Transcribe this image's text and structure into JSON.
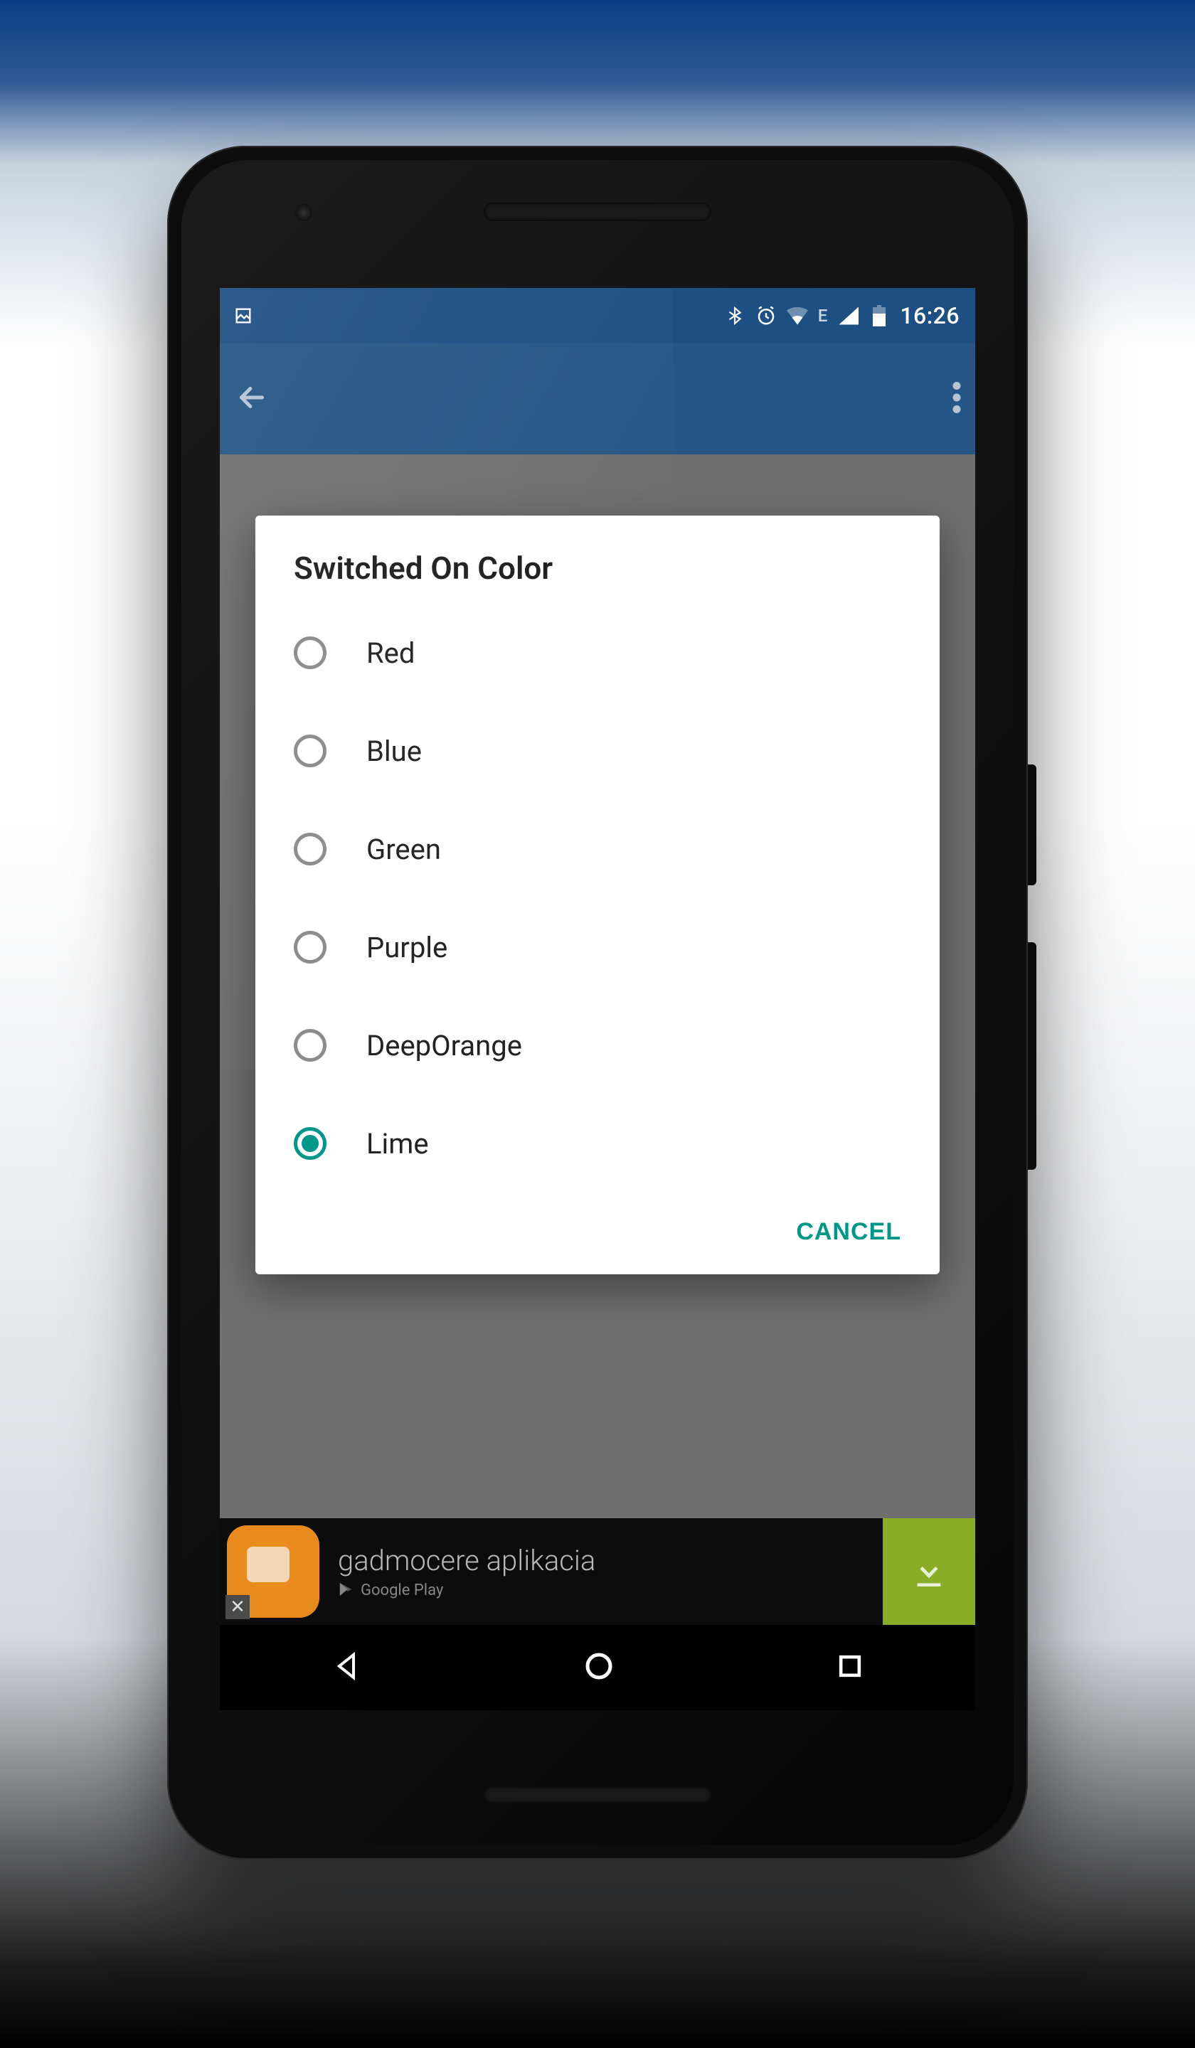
{
  "statusbar": {
    "time": "16:26",
    "network_label": "E"
  },
  "dialog": {
    "title": "Switched On Color",
    "options": [
      {
        "label": "Red",
        "selected": false
      },
      {
        "label": "Blue",
        "selected": false
      },
      {
        "label": "Green",
        "selected": false
      },
      {
        "label": "Purple",
        "selected": false
      },
      {
        "label": "DeepOrange",
        "selected": false
      },
      {
        "label": "Lime",
        "selected": true
      }
    ],
    "cancel_label": "CANCEL"
  },
  "ad": {
    "title": "gadmocere aplikacia",
    "store_label": "Google Play"
  },
  "colors": {
    "accent": "#009688",
    "appbar": "#255685",
    "statusbar": "#1d4f82"
  }
}
